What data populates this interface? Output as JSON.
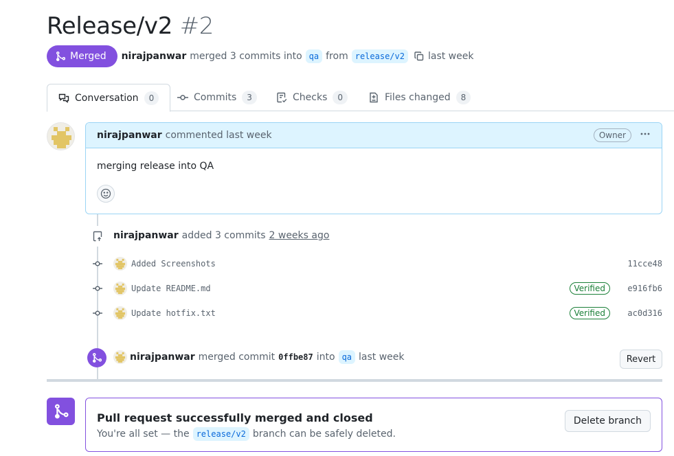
{
  "pr": {
    "title": "Release/v2",
    "number": "#2",
    "state_label": "Merged",
    "author": "nirajpanwar",
    "merged_text": "merged 3 commits into",
    "base_branch": "qa",
    "from_text": "from",
    "head_branch": "release/v2",
    "time": "last week"
  },
  "tabs": [
    {
      "label": "Conversation",
      "count": "0"
    },
    {
      "label": "Commits",
      "count": "3"
    },
    {
      "label": "Checks",
      "count": "0"
    },
    {
      "label": "Files changed",
      "count": "8"
    }
  ],
  "comment": {
    "author": "nirajpanwar",
    "action": "commented last week",
    "role": "Owner",
    "body": "merging release into QA"
  },
  "commits_event": {
    "author": "nirajpanwar",
    "action": "added 3 commits",
    "time": "2 weeks ago",
    "commits": [
      {
        "message": "Added Screenshots",
        "verified": "",
        "sha": "11cce48"
      },
      {
        "message": "Update README.md",
        "verified": "Verified",
        "sha": "e916fb6"
      },
      {
        "message": "Update hotfix.txt",
        "verified": "Verified",
        "sha": "ac0d316"
      }
    ]
  },
  "merge_event": {
    "author": "nirajpanwar",
    "action": "merged commit",
    "sha": "0ffbe87",
    "into_text": "into",
    "branch": "qa",
    "time": "last week",
    "revert_label": "Revert"
  },
  "status": {
    "title": "Pull request successfully merged and closed",
    "desc_prefix": "You're all set — the",
    "branch": "release/v2",
    "desc_suffix": "branch can be safely deleted.",
    "delete_label": "Delete branch"
  },
  "colors": {
    "merged": "#8250df",
    "link": "#0969da",
    "verified": "#1a7f37",
    "comment_header_bg": "#ddf4ff"
  }
}
